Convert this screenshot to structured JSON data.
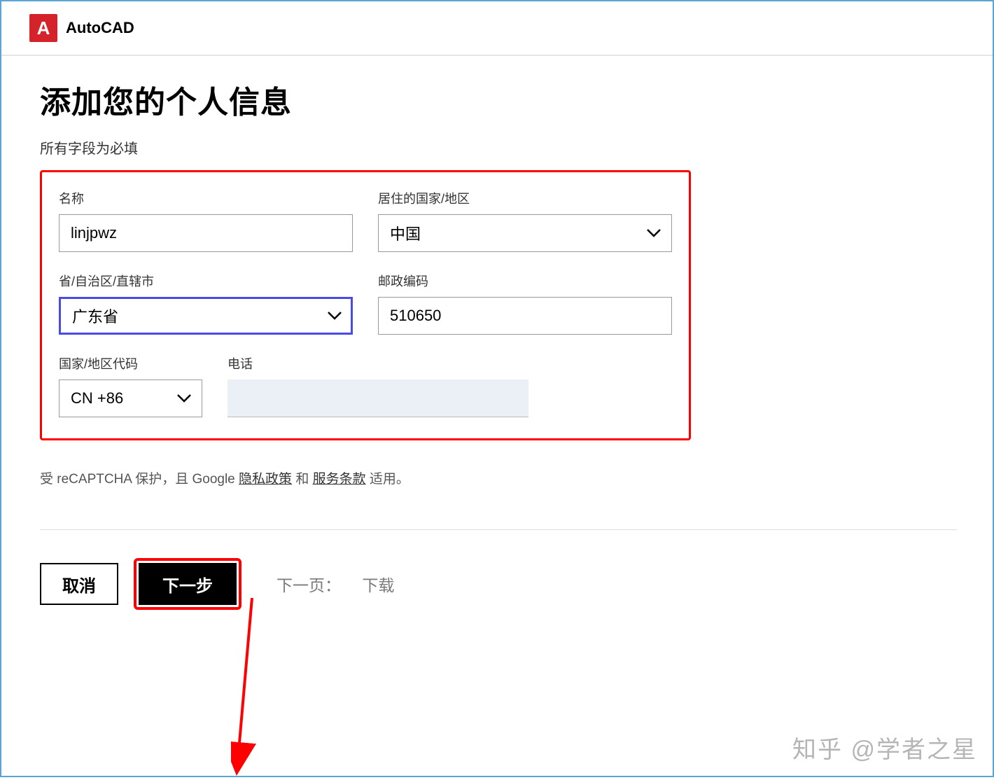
{
  "header": {
    "logo_letter": "A",
    "product_name": "AutoCAD"
  },
  "page": {
    "title": "添加您的个人信息",
    "required_note": "所有字段为必填"
  },
  "form": {
    "name": {
      "label": "名称",
      "value": "linjpwz"
    },
    "country": {
      "label": "居住的国家/地区",
      "value": "中国"
    },
    "province": {
      "label": "省/自治区/直辖市",
      "value": "广东省"
    },
    "postal": {
      "label": "邮政编码",
      "value": "510650"
    },
    "dial_code": {
      "label": "国家/地区代码",
      "value": "CN +86"
    },
    "phone": {
      "label": "电话",
      "value": ""
    }
  },
  "recaptcha": {
    "prefix": "受 reCAPTCHA 保护，且 Google ",
    "privacy_link": "隐私政策",
    "mid": "和",
    "terms_link": "服务条款",
    "suffix": "适用。"
  },
  "footer": {
    "cancel": "取消",
    "next": "下一步",
    "next_page_label": "下一页：",
    "next_page_value": "下载"
  },
  "watermark": "知乎 @学者之星"
}
